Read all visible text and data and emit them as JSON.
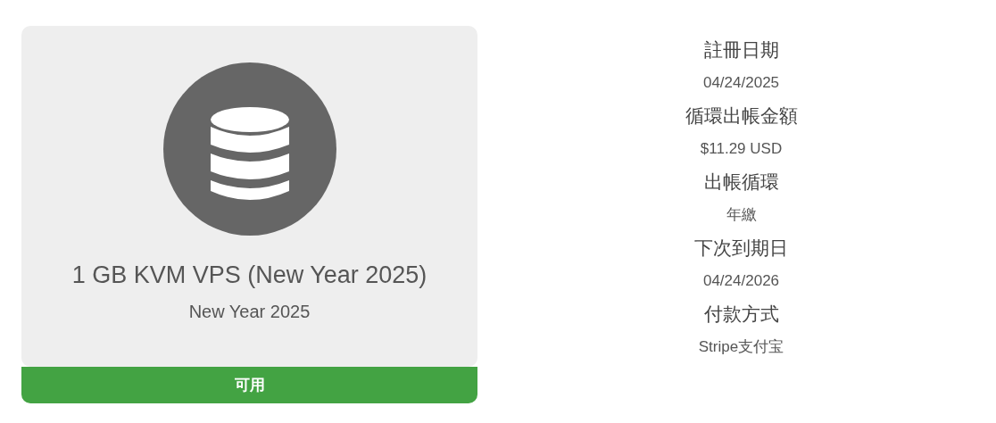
{
  "product": {
    "title": "1 GB KVM VPS (New Year 2025)",
    "subtitle": "New Year 2025",
    "status": "可用"
  },
  "details": [
    {
      "label": "註冊日期",
      "value": "04/24/2025"
    },
    {
      "label": "循環出帳金額",
      "value": "$11.29 USD"
    },
    {
      "label": "出帳循環",
      "value": "年繳"
    },
    {
      "label": "下次到期日",
      "value": "04/24/2026"
    },
    {
      "label": "付款方式",
      "value": "Stripe支付宝"
    }
  ]
}
